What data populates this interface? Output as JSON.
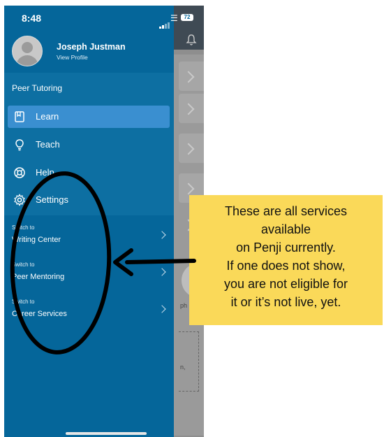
{
  "status_bar": {
    "time": "8:48",
    "battery": "72"
  },
  "profile": {
    "name": "Joseph Justman",
    "link": "View Profile"
  },
  "menu": {
    "section_title": "Peer Tutoring",
    "items": [
      {
        "label": "Learn",
        "icon": "book-icon",
        "active": true
      },
      {
        "label": "Teach",
        "icon": "lightbulb-icon",
        "active": false
      },
      {
        "label": "Help",
        "icon": "lifebuoy-icon",
        "active": false
      },
      {
        "label": "Settings",
        "icon": "gear-icon",
        "active": false
      }
    ]
  },
  "switches": [
    {
      "prefix": "Switch to",
      "label": "Writing Center"
    },
    {
      "prefix": "Switch to",
      "label": "Peer Mentoring"
    },
    {
      "prefix": "Switch to",
      "label": "Career Services"
    }
  ],
  "background": {
    "snippet_1": "ph",
    "snippet_2": "n,"
  },
  "annotation": {
    "text": "These are all services\navailable\non Penji currently.\nIf one does not show,\nyou are not eligible for\nit or it’s not live, yet.",
    "callout_color": "#fad959",
    "circle_color": "#000000"
  },
  "colors": {
    "drawer": "#05669a",
    "active_item": "#3a8fd0"
  }
}
